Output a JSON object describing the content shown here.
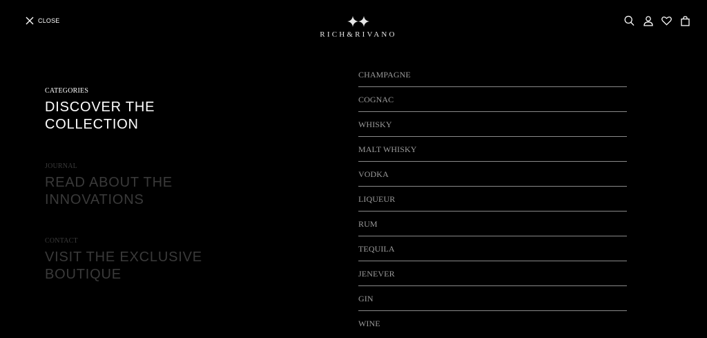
{
  "header": {
    "close_label": "CLOSE",
    "logo_text": "RICH&RIVANO",
    "icons": [
      "search-icon",
      "account-icon",
      "wishlist-icon",
      "cart-icon"
    ]
  },
  "sections": [
    {
      "kicker": "CATEGORIES",
      "heading": "DISCOVER THE COLLECTION",
      "state": "active"
    },
    {
      "kicker": "JOURNAL",
      "heading": "READ ABOUT THE INNOVATIONS",
      "state": "dim"
    },
    {
      "kicker": "CONTACT",
      "heading": "VISIT THE EXCLUSIVE BOUTIQUE",
      "state": "dim"
    }
  ],
  "categories": [
    "CHAMPAGNE",
    "COGNAC",
    "WHISKY",
    "MALT WHISKY",
    "VODKA",
    "LIQUEUR",
    "RUM",
    "TEQUILA",
    "JENEVER",
    "GIN",
    "WINE"
  ],
  "colors": {
    "background": "#000000",
    "text": "#ffffff",
    "dim_text": "#3a3a3a",
    "list_text": "#9a9a9a",
    "divider": "#8a8a8a"
  }
}
